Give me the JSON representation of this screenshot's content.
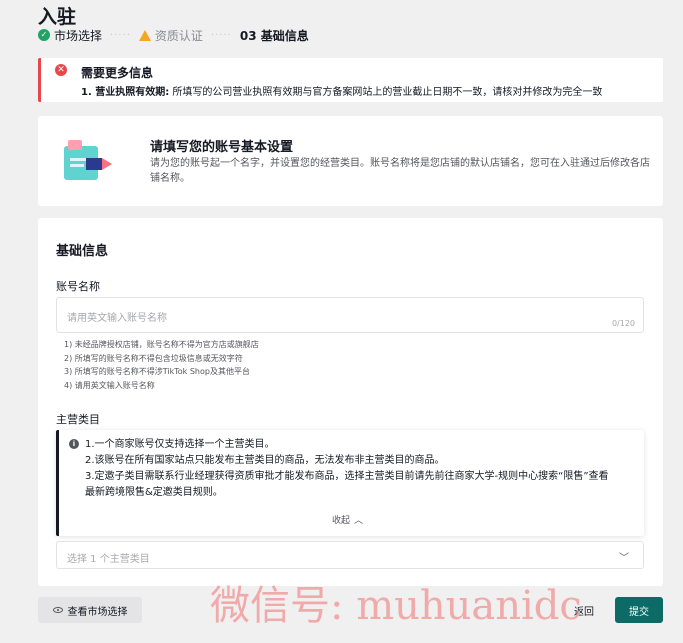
{
  "page": {
    "title": "入驻"
  },
  "steps": [
    {
      "label": "市场选择",
      "status": "done"
    },
    {
      "label": "资质认证",
      "status": "warning"
    },
    {
      "label": "03 基础信息",
      "status": "current"
    }
  ],
  "steps_separator": "·····",
  "alert": {
    "title": "需要更多信息",
    "item_label": "1. 营业执照有效期:",
    "item_text": " 所填写的公司营业执照有效期与官方备案网站上的营业截止日期不一致，请核对并修改为完全一致"
  },
  "intro": {
    "title": "请填写您的账号基本设置",
    "desc": "请为您的账号起一个名字，并设置您的经营类目。账号名称将是您店铺的默认店铺名，您可在入驻通过后修改各店铺名称。"
  },
  "form": {
    "section_title": "基础信息",
    "account_name": {
      "label": "账号名称",
      "placeholder": "请用英文输入账号名称",
      "counter": "0/120",
      "hints": [
        "1) 未经品牌授权店铺，账号名称不得为官方店或旗舰店",
        "2) 所填写的账号名称不得包含垃圾信息或无效字符",
        "3) 所填写的账号名称不得涉TikTok Shop及其他平台",
        "4) 请用英文输入账号名称"
      ]
    },
    "category": {
      "label": "主营类目",
      "notice": [
        "1.一个商家账号仅支持选择一个主营类目。",
        "2.该账号在所有国家站点只能发布主营类目的商品，无法发布非主营类目的商品。",
        "3.定邀子类目需联系行业经理获得资质审批才能发布商品，选择主营类目前请先前往商家大学-规则中心搜索“限售”查看最新跨境限售&定邀类目规则。"
      ],
      "collapse_label": "收起",
      "placeholder": "选择 1 个主营类目"
    }
  },
  "footer": {
    "view_market": "查看市场选择",
    "back": "返回",
    "submit": "提交"
  },
  "watermark": "微信号: muhuanidc",
  "colors": {
    "accent": "#0c6b66",
    "error": "#e8464b",
    "success": "#21a366",
    "warning": "#f5a623"
  }
}
